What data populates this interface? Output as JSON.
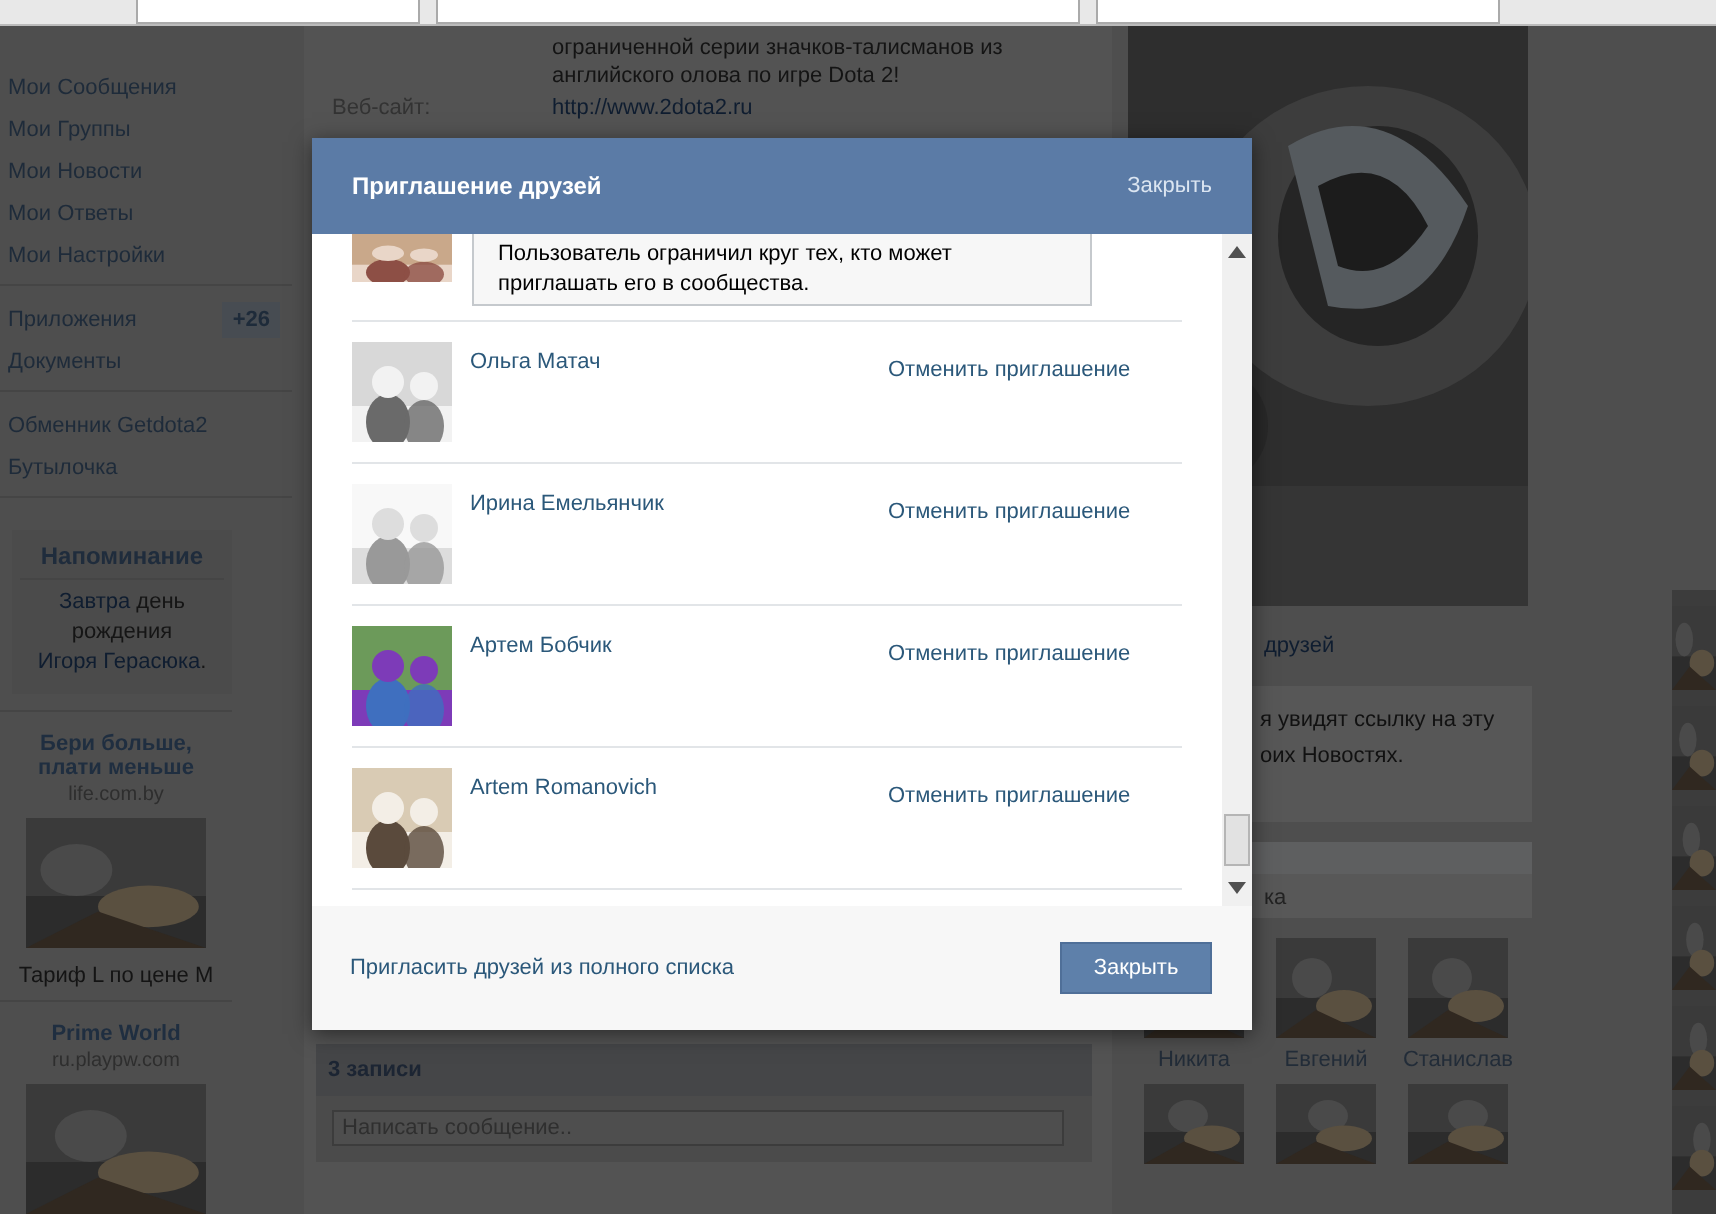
{
  "sidebar": {
    "groups": [
      {
        "items": [
          {
            "label": "Мои Сообщения"
          },
          {
            "label": "Мои Группы"
          },
          {
            "label": "Мои Новости"
          },
          {
            "label": "Мои Ответы"
          },
          {
            "label": "Мои Настройки"
          }
        ]
      },
      {
        "items": [
          {
            "label": "Приложения",
            "badge": "+26"
          },
          {
            "label": "Документы"
          }
        ]
      },
      {
        "items": [
          {
            "label": "Обменник Getdota2"
          },
          {
            "label": "Бутылочка"
          }
        ]
      }
    ],
    "reminder": {
      "title": "Напоминание",
      "segments": [
        {
          "text": "Завтра",
          "link": true
        },
        {
          "text": "день рождения",
          "link": false
        },
        {
          "text": "Игоря Герасюка",
          "link": true
        },
        {
          "text": ".",
          "link": false
        }
      ]
    },
    "ads": [
      {
        "title": "Бери больше, плати меньше",
        "domain": "life.com.by",
        "caption": "Тариф L по цене М"
      },
      {
        "title": "Prime World",
        "domain": "ru.playpw.com"
      }
    ]
  },
  "group_info": {
    "description": "ограниченной серии значков-талисманов из английского олова по игре Dota 2!",
    "website_label": "Веб-сайт:",
    "website": "http://www.2dota2.ru"
  },
  "wall": {
    "title": "3 записи",
    "input": {
      "placeholder": "Написать сообщение.."
    }
  },
  "right": {
    "friends_link": "друзей",
    "share_lines": [
      "я увидят ссылку на эту",
      "оих Новостях."
    ],
    "members_label": "ка",
    "members": [
      {
        "name": "Никита"
      },
      {
        "name": "Евгений"
      },
      {
        "name": "Станислав"
      }
    ]
  },
  "dialog": {
    "title": "Приглашение друзей",
    "close_link": "Закрыть",
    "rows": [
      {
        "kind": "restricted",
        "notice": "Пользователь ограничил круг тех, кто может приглашать его в сообщества."
      },
      {
        "kind": "invited",
        "name": "Ольга Матач",
        "action": "Отменить приглашение"
      },
      {
        "kind": "invited",
        "name": "Ирина Емельянчик",
        "action": "Отменить приглашение"
      },
      {
        "kind": "invited",
        "name": "Артем Бобчик",
        "action": "Отменить приглашение"
      },
      {
        "kind": "invited",
        "name": "Artem Romanovich",
        "action": "Отменить приглашение"
      }
    ],
    "footer_link": "Пригласить друзей из полного списка",
    "close_button": "Закрыть"
  }
}
